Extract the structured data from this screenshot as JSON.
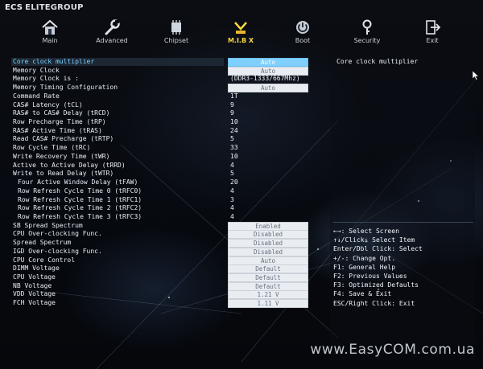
{
  "brand": {
    "logo_text": "ECS",
    "name": "ELITEGROUP"
  },
  "tabs": [
    {
      "label": "Main",
      "icon": "home-icon",
      "active": false
    },
    {
      "label": "Advanced",
      "icon": "wrench-icon",
      "active": false
    },
    {
      "label": "Chipset",
      "icon": "chip-icon",
      "active": false
    },
    {
      "label": "M.I.B X",
      "icon": "mib-icon",
      "active": true
    },
    {
      "label": "Boot",
      "icon": "power-icon",
      "active": false
    },
    {
      "label": "Security",
      "icon": "key-icon",
      "active": false
    },
    {
      "label": "Exit",
      "icon": "exit-icon",
      "active": false
    }
  ],
  "settings": [
    {
      "label": "Core clock multiplier",
      "value": "Auto",
      "kind": "box",
      "selected": true
    },
    {
      "label": "Memory Clock",
      "value": "Auto",
      "kind": "box"
    },
    {
      "label": "Memory Clock is :",
      "value": "(DDR3-1333/667Mhz)",
      "kind": "text"
    },
    {
      "label": "Memory Timing Configuration",
      "value": "Auto",
      "kind": "box"
    },
    {
      "label": "Command Rate",
      "value": "1T",
      "kind": "text"
    },
    {
      "label": "CAS# Latency (tCL)",
      "value": "9",
      "kind": "text"
    },
    {
      "label": "RAS# to CAS# Delay (tRCD)",
      "value": "9",
      "kind": "text"
    },
    {
      "label": "Row Precharge Time (tRP)",
      "value": "10",
      "kind": "text"
    },
    {
      "label": "RAS# Active Time (tRAS)",
      "value": "24",
      "kind": "text"
    },
    {
      "label": "Read CAS# Precharge (tRTP)",
      "value": "5",
      "kind": "text"
    },
    {
      "label": "Row Cycle Time (tRC)",
      "value": "33",
      "kind": "text"
    },
    {
      "label": "Write Recovery Time (tWR)",
      "value": "10",
      "kind": "text"
    },
    {
      "label": "Active to Active Delay (tRRD)",
      "value": "4",
      "kind": "text"
    },
    {
      "label": "Write to Read Delay (tWTR)",
      "value": "5",
      "kind": "text"
    },
    {
      "label": "Four Active Window Delay (tFAW)",
      "value": "20",
      "kind": "text"
    },
    {
      "label": "Row Refresh Cycle Time 0 (tRFC0)",
      "value": "4",
      "kind": "text"
    },
    {
      "label": "Row Refresh Cycle Time 1 (tRFC1)",
      "value": "3",
      "kind": "text"
    },
    {
      "label": "Row Refresh Cycle Time 2 (tRFC2)",
      "value": "4",
      "kind": "text"
    },
    {
      "label": "Row Refresh Cycle Time 3 (tRFC3)",
      "value": "4",
      "kind": "text"
    },
    {
      "label": "SB Spread Spectrum",
      "value": "Enabled",
      "kind": "box"
    },
    {
      "label": "CPU Over-clocking Func.",
      "value": "Disabled",
      "kind": "box"
    },
    {
      "label": "Spread Spectrum",
      "value": "Disabled",
      "kind": "box"
    },
    {
      "label": "IGD Over-clocking Func.",
      "value": "Disabled",
      "kind": "box"
    },
    {
      "label": "CPU Core Control",
      "value": "Auto",
      "kind": "box"
    },
    {
      "label": "DIMM Voltage",
      "value": "Default",
      "kind": "box"
    },
    {
      "label": "CPU Voltage",
      "value": "Default",
      "kind": "box"
    },
    {
      "label": "NB Voltage",
      "value": "Default",
      "kind": "box"
    },
    {
      "label": "VDD Voltage",
      "value": "1.21 V",
      "kind": "box"
    },
    {
      "label": "FCH Voltage",
      "value": "1.11 V",
      "kind": "box"
    }
  ],
  "help": {
    "title": "Core clock multiplier",
    "hints": [
      "←→: Select Screen",
      "↑↓/Click: Select Item",
      "Enter/Dbl Click: Select",
      "+/-: Change Opt.",
      "F1: General Help",
      "F2: Previous Values",
      "F3: Optimized Defaults",
      "F4: Save & Exit",
      "ESC/Right Click: Exit"
    ]
  },
  "watermark": "www.EasyCOM.com.ua",
  "colors": {
    "accent": "#f6d640",
    "selected_text": "#7ad2ff",
    "selected_box": "#7fd0ff"
  }
}
